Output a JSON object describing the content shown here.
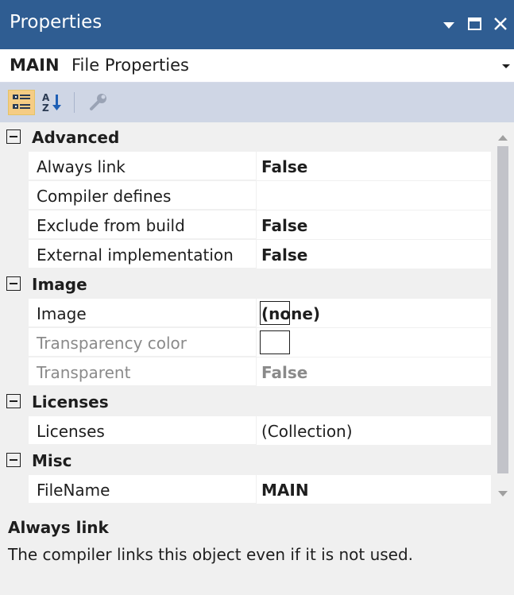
{
  "panel": {
    "title": "Properties",
    "controls": {
      "dropdown_icon": "dropdown-triangle-icon",
      "maximize_icon": "maximize-icon",
      "close_icon": "close-icon"
    }
  },
  "object_selector": {
    "name": "MAIN",
    "type": "File Properties",
    "arrow_icon": "chevron-down-icon"
  },
  "toolbar": {
    "buttons": [
      {
        "icon": "categorized-icon",
        "active": true
      },
      {
        "icon": "alphabetical-sort-icon",
        "active": false
      },
      {
        "icon": "property-pages-wrench-icon",
        "active": false
      }
    ]
  },
  "grid": {
    "categories": [
      {
        "label": "Advanced",
        "properties": [
          {
            "name": "Always link",
            "value": "False"
          },
          {
            "name": "Compiler defines",
            "value": ""
          },
          {
            "name": "Exclude from build",
            "value": "False"
          },
          {
            "name": "External implementation",
            "value": "False"
          }
        ]
      },
      {
        "label": "Image",
        "properties": [
          {
            "name": "Image",
            "value": "(none)"
          },
          {
            "name": "Transparency color",
            "value": ""
          },
          {
            "name": "Transparent",
            "value": "False"
          }
        ]
      },
      {
        "label": "Licenses",
        "properties": [
          {
            "name": "Licenses",
            "value": "(Collection)"
          }
        ]
      },
      {
        "label": "Misc",
        "properties": [
          {
            "name": "FileName",
            "value": "MAIN"
          }
        ]
      }
    ]
  },
  "description": {
    "title": "Always link",
    "text": "The compiler links this object even if it is not used."
  },
  "colors": {
    "title_bar": "#2f5d92",
    "toolbar": "#cfd6e5",
    "active_toolbar_button": "#f5cc84",
    "grid_background": "#f0f0f0",
    "scroll_thumb": "#c2c3c9",
    "disabled_text": "#8a8a8a"
  }
}
